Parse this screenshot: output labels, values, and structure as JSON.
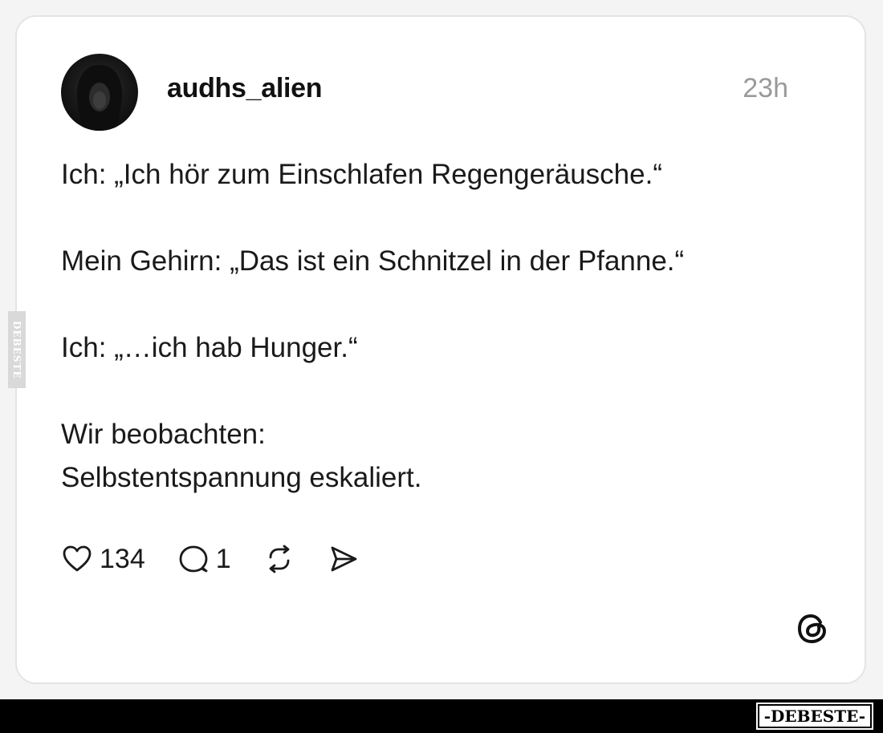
{
  "post": {
    "username": "audhs_alien",
    "time": "23h",
    "paragraphs": [
      "Ich: „Ich hör zum Einschlafen Regengeräusche.“",
      "Mein Gehirn: „Das ist ein Schnitzel in der Pfanne.“",
      "Ich: „…ich hab Hunger.“",
      "Wir beobachten:\nSelbstentspannung eskaliert."
    ]
  },
  "actions": {
    "likes": "134",
    "replies": "1",
    "icons": [
      "heart-icon",
      "comment-icon",
      "repost-icon",
      "share-icon"
    ]
  },
  "branding": {
    "side_watermark": "DEBESTE",
    "bottom_watermark": "-DEBESTE-",
    "app_logo": "threads-logo-icon"
  },
  "colors": {
    "text": "#1a1a1a",
    "time": "#9a9a9a",
    "card_border": "#e4e4e4",
    "bottom_bar": "#000000"
  }
}
